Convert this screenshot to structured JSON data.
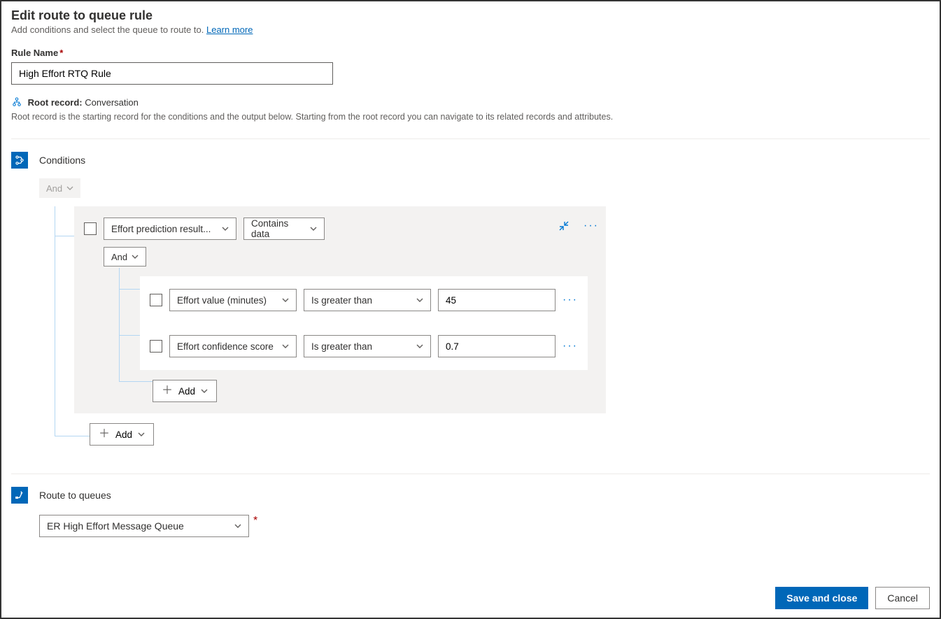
{
  "header": {
    "title": "Edit route to queue rule",
    "subtitle_prefix": "Add conditions and select the queue to route to. ",
    "learn_more": "Learn more"
  },
  "rule_name": {
    "label": "Rule Name",
    "value": "High Effort RTQ Rule"
  },
  "root_record": {
    "label": "Root record:",
    "value": "Conversation",
    "help": "Root record is the starting record for the conditions and the output below. Starting from the root record you can navigate to its related records and attributes."
  },
  "conditions": {
    "section_title": "Conditions",
    "root_operator": "And",
    "group": {
      "entity": "Effort prediction result...",
      "operator_dd": "Contains data",
      "inner_operator": "And",
      "rows": [
        {
          "field": "Effort value (minutes)",
          "op": "Is greater than",
          "value": "45"
        },
        {
          "field": "Effort confidence score",
          "op": "Is greater than",
          "value": "0.7"
        }
      ],
      "add_label_inner": "Add"
    },
    "add_label_outer": "Add"
  },
  "route": {
    "section_title": "Route to queues",
    "queue_value": "ER High Effort Message Queue"
  },
  "footer": {
    "save": "Save and close",
    "cancel": "Cancel"
  }
}
